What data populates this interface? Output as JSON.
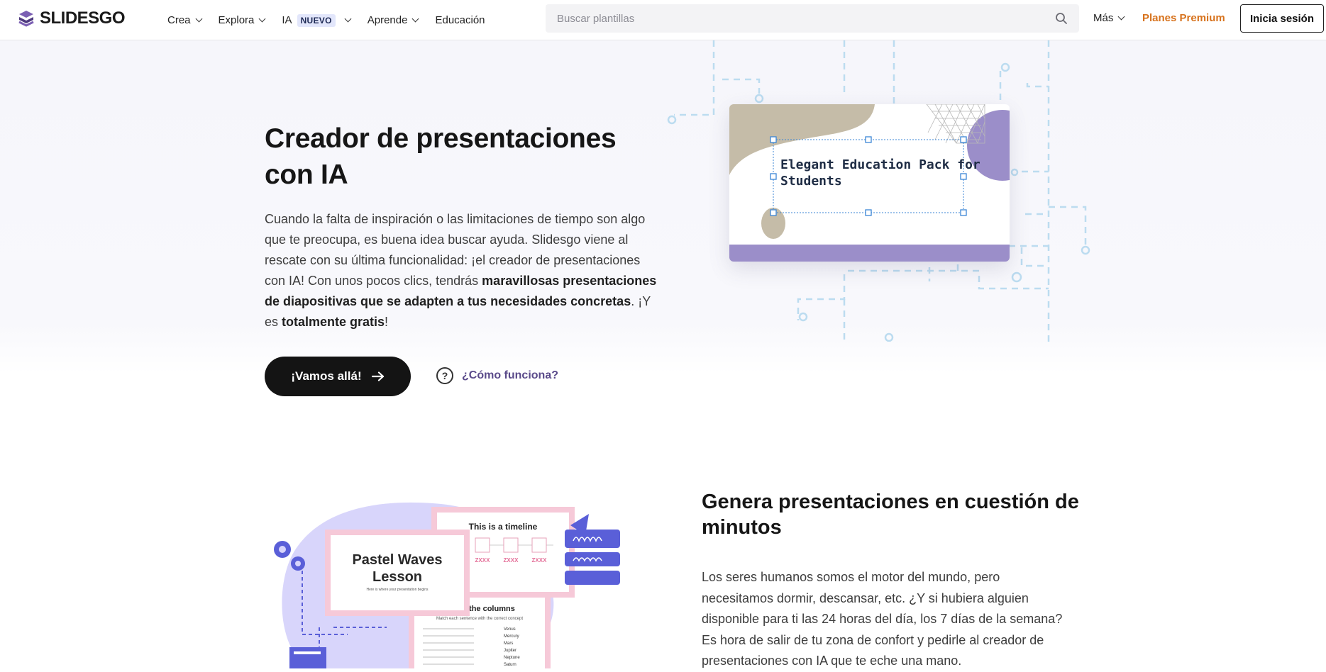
{
  "brand": {
    "name": "SLIDESGO",
    "logo_color": "#7b5fb3"
  },
  "nav": {
    "items": [
      {
        "label": "Crea",
        "dropdown": true
      },
      {
        "label": "Explora",
        "dropdown": true
      },
      {
        "label": "IA",
        "badge": "NUEVO",
        "dropdown": true
      },
      {
        "label": "Aprende",
        "dropdown": true
      },
      {
        "label": "Educación",
        "dropdown": false
      }
    ],
    "search_placeholder": "Buscar plantillas",
    "more_label": "Más",
    "premium_label": "Planes Premium",
    "login_label": "Inicia sesión"
  },
  "hero": {
    "title": "Creador de presentaciones con IA",
    "text_1": "Cuando la falta de inspiración o las limitaciones de tiempo son algo que te preocupa, es buena idea buscar ayuda. Slidesgo viene al rescate con su última funcionalidad: ¡el creador de presentaciones con IA! Con unos pocos clics, tendrás ",
    "text_bold_1": "maravillosas presentaciones de diapositivas que se adapten a tus necesidades concretas",
    "text_2": ". ¡Y es ",
    "text_bold_2": "totalmente gratis",
    "text_3": "!",
    "cta_label": "¡Vamos allá!",
    "how_label": "¿Cómo funciona?",
    "slide_preview_title": "Elegant Education Pack for Students"
  },
  "section2": {
    "title": "Genera presentaciones en cuestión de minutos",
    "text": "Los seres humanos somos el motor del mundo, pero necesitamos dormir, descansar, etc. ¿Y si hubiera alguien disponible para ti las 24 horas del día, los 7 días de la semana? Es hora de salir de tu zona de confort y pedirle al creador de presentaciones con IA que te eche una mano.",
    "illustration": {
      "card_main_title": "Pastel Waves Lesson",
      "card_main_subtitle": "Here is where your presentation begins",
      "card_timeline_title": "This is a timeline",
      "timeline_labels": [
        "ZXXX",
        "ZXXX",
        "ZXXX"
      ],
      "card_columns_title": "Match the columns",
      "card_columns_subtitle": "Match each sentence with the correct concept",
      "columns_words": [
        "Venus",
        "Mercury",
        "Mars",
        "Jupiter",
        "Neptune",
        "Saturn"
      ]
    }
  },
  "colors": {
    "accent_purple": "#9b8ec9",
    "beige": "#c4bba7",
    "premium_orange": "#d7721c",
    "selection_blue": "#3b86d6",
    "circuit_blue": "#bcdcf0"
  }
}
